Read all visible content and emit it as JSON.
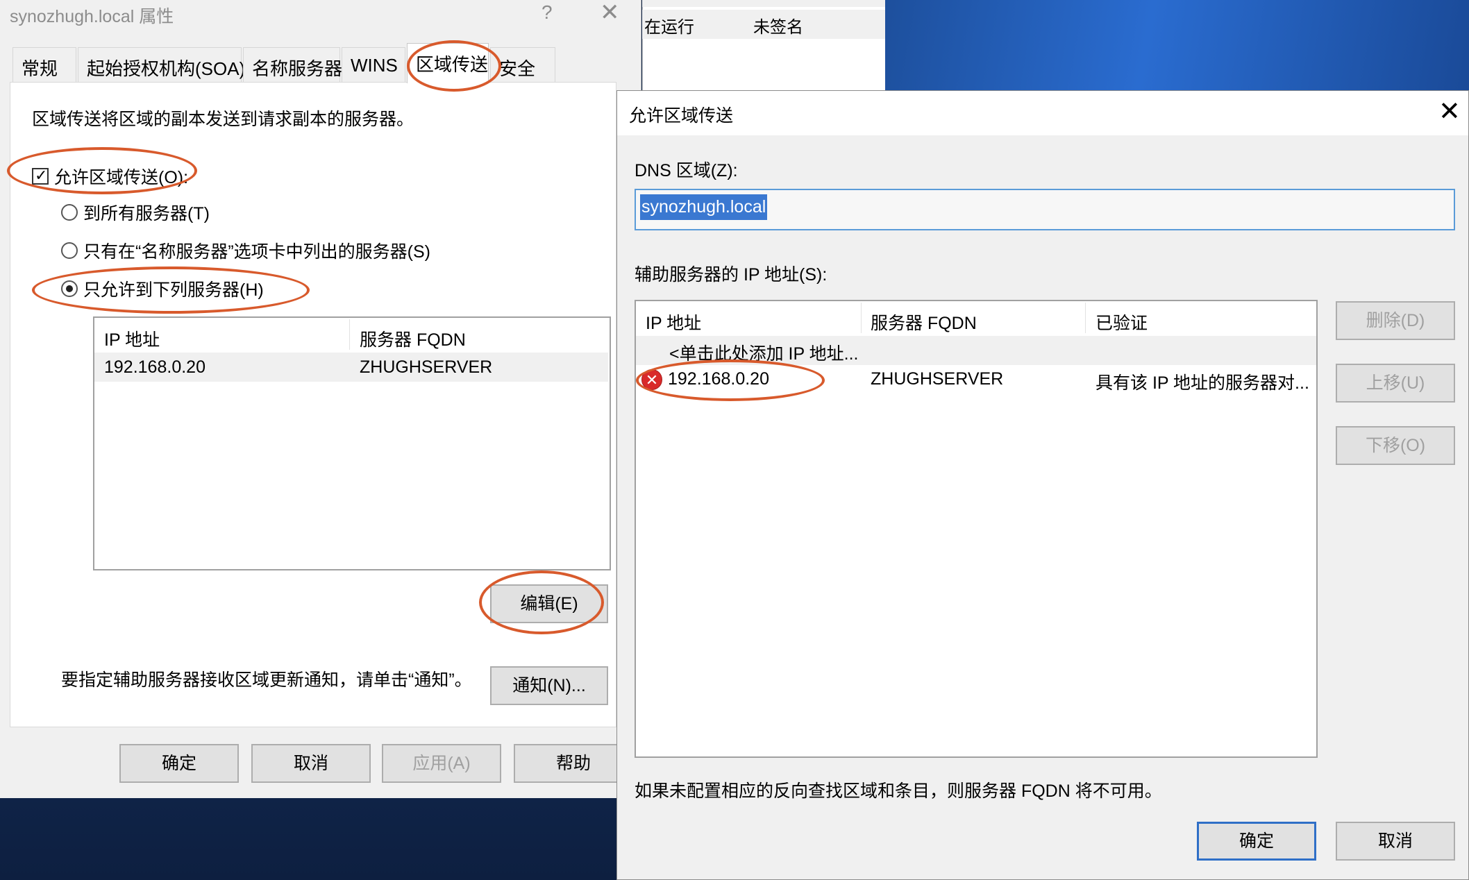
{
  "background_window": {
    "status": "在运行",
    "signing": "未签名"
  },
  "properties_dialog": {
    "title": "synozhugh.local 属性",
    "help_glyph": "?",
    "close_glyph": "✕",
    "tabs": [
      {
        "label": "常规"
      },
      {
        "label": "起始授权机构(SOA)"
      },
      {
        "label": "名称服务器"
      },
      {
        "label": "WINS"
      },
      {
        "label": "区域传送"
      },
      {
        "label": "安全"
      }
    ],
    "description": "区域传送将区域的副本发送到请求副本的服务器。",
    "allow_transfer_label": "允许区域传送(O):",
    "options": {
      "all_servers": "到所有服务器(T)",
      "name_servers_tab": "只有在“名称服务器”选项卡中列出的服务器(S)",
      "following_servers": "只允许到下列服务器(H)"
    },
    "server_list": {
      "columns": [
        "IP 地址",
        "服务器 FQDN"
      ],
      "rows": [
        {
          "ip": "192.168.0.20",
          "fqdn": "ZHUGHSERVER"
        }
      ]
    },
    "edit_button": "编辑(E)",
    "notify_hint": "要指定辅助服务器接收区域更新通知，请单击“通知”。",
    "notify_button": "通知(N)...",
    "footer_buttons": {
      "ok": "确定",
      "cancel": "取消",
      "apply": "应用(A)",
      "help": "帮助"
    }
  },
  "transfer_dialog": {
    "title": "允许区域传送",
    "close_glyph": "✕",
    "dns_zone_label": "DNS 区域(Z):",
    "dns_zone_value": "synozhugh.local",
    "secondary_label": "辅助服务器的 IP 地址(S):",
    "list": {
      "columns": [
        "IP 地址",
        "服务器 FQDN",
        "已验证"
      ],
      "add_placeholder": "<单击此处添加 IP 地址...",
      "rows": [
        {
          "ip": "192.168.0.20",
          "fqdn": "ZHUGHSERVER",
          "verified": "具有该 IP 地址的服务器对..."
        }
      ]
    },
    "side_buttons": {
      "delete": "删除(D)",
      "up": "上移(U)",
      "down": "下移(O)"
    },
    "footer_note": "如果未配置相应的反向查找区域和条目，则服务器 FQDN 将不可用。",
    "ok": "确定",
    "cancel": "取消"
  },
  "colors": {
    "annotation": "#d85a2c",
    "selection": "#3a78d1",
    "error": "#d92a2a"
  }
}
